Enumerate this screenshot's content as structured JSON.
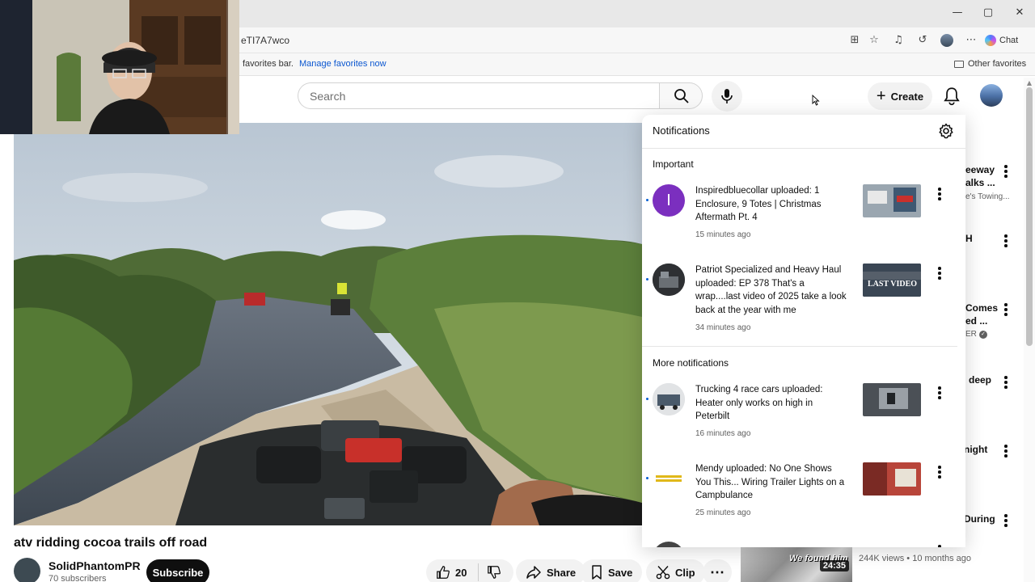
{
  "browser": {
    "url": "eTI7A7wco",
    "chat_label": "Chat",
    "favorites_text": "favorites bar.",
    "manage_favorites": "Manage favorites now",
    "other_favorites": "Other favorites"
  },
  "masthead": {
    "search_placeholder": "Search",
    "create_label": "Create"
  },
  "video": {
    "title": "atv ridding cocoa trails off road",
    "channel_name": "SolidPhantomPR",
    "subscribers": "70 subscribers",
    "subscribe_label": "Subscribe",
    "like_count": "20",
    "share_label": "Share",
    "save_label": "Save",
    "clip_label": "Clip"
  },
  "notifications": {
    "title": "Notifications",
    "important_label": "Important",
    "more_label": "More notifications",
    "items": [
      {
        "text": "Inspiredbluecollar uploaded: 1 Enclosure, 9 Totes | Christmas Aftermath Pt. 4",
        "time": "15 minutes ago",
        "avatar_letter": "I",
        "avatar_color": "#7b2fbf"
      },
      {
        "text": "Patriot Specialized and Heavy Haul uploaded: EP 378 That's a wrap....last video of 2025 take a look back at the year with me",
        "time": "34 minutes ago",
        "thumb_text": "LAST VIDEO"
      },
      {
        "text": "Trucking 4 race cars uploaded: Heater only works on high in Peterbilt",
        "time": "16 minutes ago"
      },
      {
        "text": "Mendy uploaded: No One Shows You This... Wiring Trailer Lights on a Campbulance",
        "time": "25 minutes ago"
      }
    ]
  },
  "sidebar": {
    "items": [
      {
        "line1": "eeway",
        "line2": "alks ...",
        "sub": "e's Towing..."
      },
      {
        "line1": "H"
      },
      {
        "line1": "Comes",
        "line2": "ed ...",
        "sub": "ER"
      },
      {
        "line1": "deep"
      },
      {
        "line1": "night"
      },
      {
        "line1": "During"
      }
    ],
    "bottom_thumb_text": "We found him",
    "bottom_duration": "24:35",
    "bottom_meta": "244K views • 10 months ago"
  },
  "colors": {
    "accent_blue": "#065fd4",
    "subscribe_bg": "#0f0f0f"
  }
}
